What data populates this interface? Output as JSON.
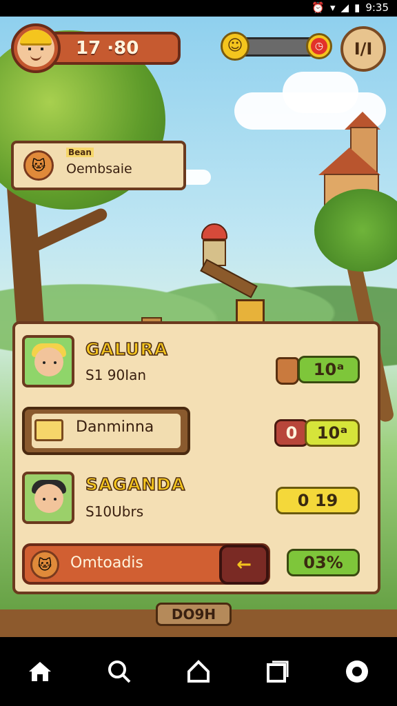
{
  "status_bar": {
    "time": "9:35",
    "icons": [
      "alarm-icon",
      "wifi-icon",
      "signal-icon",
      "battery-icon"
    ]
  },
  "hud": {
    "score": "17 ·80",
    "pause_label": "I/I",
    "energy_icon": "smiley-coin-icon",
    "alert_icon": "clock-icon"
  },
  "quest_sign": {
    "tag": "Bean",
    "title": "Oembsaie"
  },
  "panel": {
    "rows": [
      {
        "name": "GALURA",
        "sub": "S1 90Ian",
        "badge": "10ᵃ",
        "badge_color": "green"
      },
      {
        "label": "Danminna",
        "badge_left": "0",
        "badge": "10ᵃ",
        "badge_color": "green"
      },
      {
        "name": "SAGANDA",
        "sub": "S10Ubrs",
        "badge": "0 19",
        "badge_color": "yellow"
      },
      {
        "label": "Omtoadis",
        "arrow": "←",
        "badge": "03%",
        "badge_color": "green"
      }
    ]
  },
  "bottom_sign": "DO9H",
  "nav": {
    "items": [
      "home-icon",
      "search-icon",
      "shop-icon",
      "tabs-icon",
      "profile-icon"
    ]
  },
  "colors": {
    "wood_dark": "#6b3a1e",
    "parchment": "#f4dfb4",
    "accent_orange": "#c65a30",
    "badge_green": "#7ec63a",
    "badge_yellow": "#f4d83a"
  }
}
